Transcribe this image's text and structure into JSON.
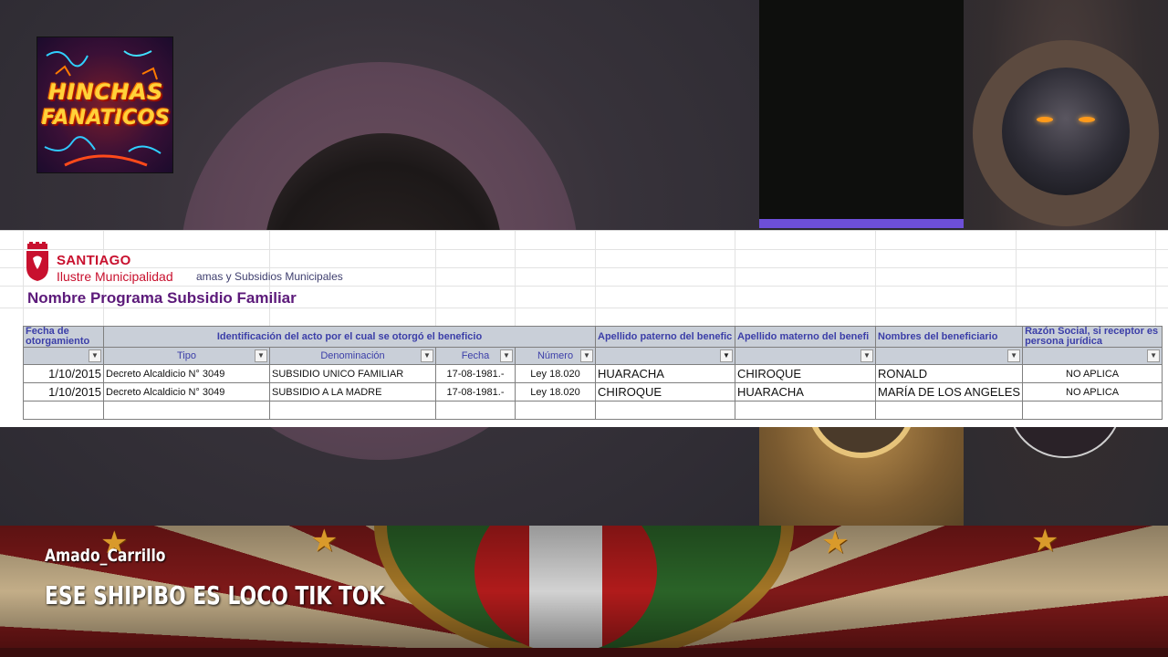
{
  "overlay": {
    "logo_line_1": "HINCHAS",
    "logo_line_2": "FANATICOS"
  },
  "spreadsheet": {
    "brand_name": "SANTIAGO",
    "brand_sub": "Ilustre Municipalidad",
    "subtitle_fragment": "amas y Subsidios Municipales",
    "title": "Nombre Programa Subsidio Familiar",
    "header_row_1": {
      "fecha_otorgamiento": "Fecha de otorgamiento",
      "identificacion": "Identificación del acto por el cual se otorgó el beneficio",
      "apellido_paterno": "Apellido paterno del benefic",
      "apellido_materno": "Apellido materno del benefi",
      "nombres": "Nombres del beneficiario",
      "razon_social": "Razón Social, si receptor es persona jurídica"
    },
    "header_row_2": {
      "tipo": "Tipo",
      "denominacion": "Denominación",
      "fecha": "Fecha",
      "numero": "Número"
    },
    "filter_icon": "▼",
    "filter_active_icon": "▼",
    "rows": [
      {
        "fecha_otorgamiento": "1/10/2015",
        "tipo": "Decreto Alcaldicio N° 3049",
        "denominacion": "SUBSIDIO UNICO FAMILIAR",
        "fecha": "17-08-1981.-",
        "numero": "Ley 18.020",
        "apellido_paterno": "HUARACHA",
        "apellido_materno": "CHIROQUE",
        "nombres": "RONALD",
        "razon_social": "NO APLICA"
      },
      {
        "fecha_otorgamiento": "1/10/2015",
        "tipo": "Decreto Alcaldicio N° 3049",
        "denominacion": "SUBSIDIO A LA MADRE",
        "fecha": "17-08-1981.-",
        "numero": "Ley 18.020",
        "apellido_paterno": "CHIROQUE",
        "apellido_materno": "HUARACHA",
        "nombres": "MARÍA DE LOS ANGELES",
        "razon_social": "NO APLICA"
      }
    ]
  },
  "comment": {
    "username": "Amado_Carrillo",
    "message": "ESE SHIPIBO ES LOCO TIK TOK"
  },
  "colors": {
    "speaking_indicator": "#6d4fd8",
    "brand_red": "#c8102e",
    "title_purple": "#5c1a7a",
    "header_blue": "#3b3ea8",
    "header_bg": "#c9cfd8"
  }
}
